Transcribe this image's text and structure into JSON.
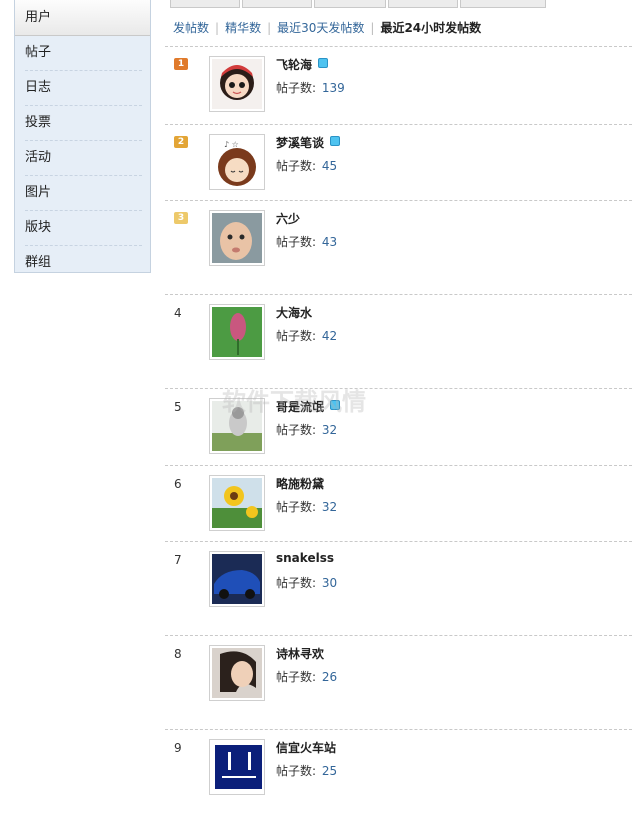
{
  "sidebar": {
    "header": "用户",
    "items": [
      {
        "label": "帖子"
      },
      {
        "label": "日志"
      },
      {
        "label": "投票"
      },
      {
        "label": "活动"
      },
      {
        "label": "图片"
      },
      {
        "label": "版块"
      },
      {
        "label": "群组"
      }
    ]
  },
  "filters": {
    "items": [
      {
        "label": "发帖数"
      },
      {
        "label": "精华数"
      },
      {
        "label": "最近30天发帖数"
      },
      {
        "label": "最近24小时发帖数",
        "active": true
      }
    ]
  },
  "ranking": {
    "count_label": "帖子数:",
    "rows": [
      {
        "rank": "1",
        "name": "飞轮海",
        "posts": "139",
        "vip": true
      },
      {
        "rank": "2",
        "name": "梦溪笔谈",
        "posts": "45",
        "vip": true
      },
      {
        "rank": "3",
        "name": "六少",
        "posts": "43",
        "vip": false
      },
      {
        "rank": "4",
        "name": "大海水",
        "posts": "42",
        "vip": false
      },
      {
        "rank": "5",
        "name": "哥是流氓",
        "posts": "32",
        "vip": true
      },
      {
        "rank": "6",
        "name": "略施粉黛",
        "posts": "32",
        "vip": false
      },
      {
        "rank": "7",
        "name": "snakelss",
        "posts": "30",
        "vip": false
      },
      {
        "rank": "8",
        "name": "诗林寻欢",
        "posts": "26",
        "vip": false
      },
      {
        "rank": "9",
        "name": "信宜火车站",
        "posts": "25",
        "vip": false
      }
    ]
  },
  "badge_colors": [
    "#e07a2b",
    "#e3a536",
    "#edc96a"
  ],
  "watermark": "软件下载风情"
}
